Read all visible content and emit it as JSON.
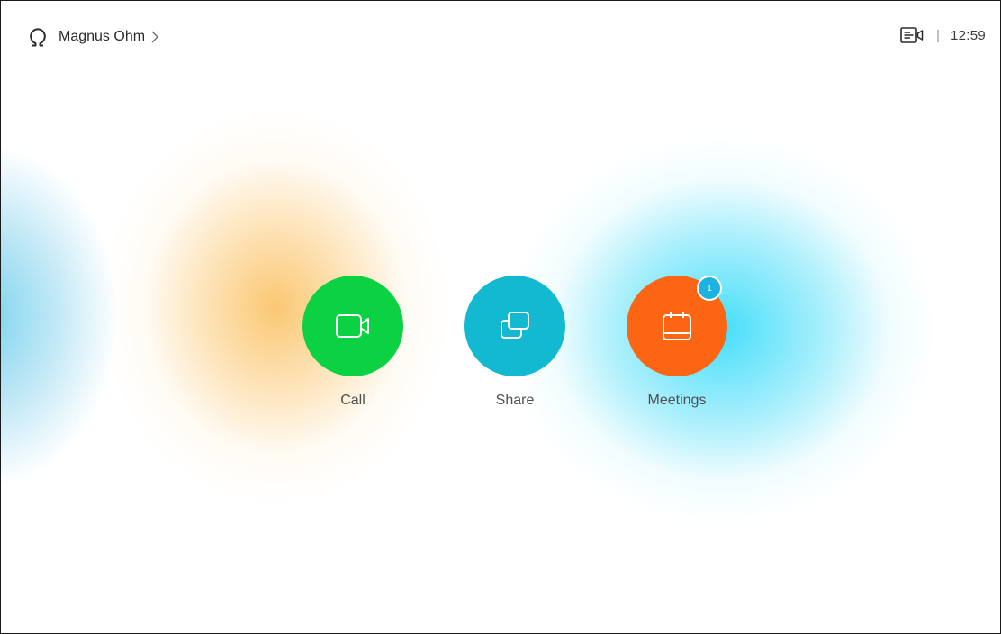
{
  "header": {
    "user_name": "Magnus Ohm",
    "time": "12:59",
    "separator": "|"
  },
  "actions": [
    {
      "label": "Call",
      "icon": "video-camera-icon",
      "color": "#0ad243"
    },
    {
      "label": "Share",
      "icon": "share-screens-icon",
      "color": "#12b9d0"
    },
    {
      "label": "Meetings",
      "icon": "calendar-icon",
      "color": "#fb6513",
      "badge": "1"
    }
  ],
  "icons": {
    "user": "omega-icon",
    "chevron": "chevron-right-icon",
    "selfview": "selfview-icon"
  },
  "colors": {
    "badge": "#1cb3e2",
    "glow_orange": "#fabe5a",
    "glow_cyan": "#3cdcfa",
    "glow_left": "#5ac8eb"
  }
}
